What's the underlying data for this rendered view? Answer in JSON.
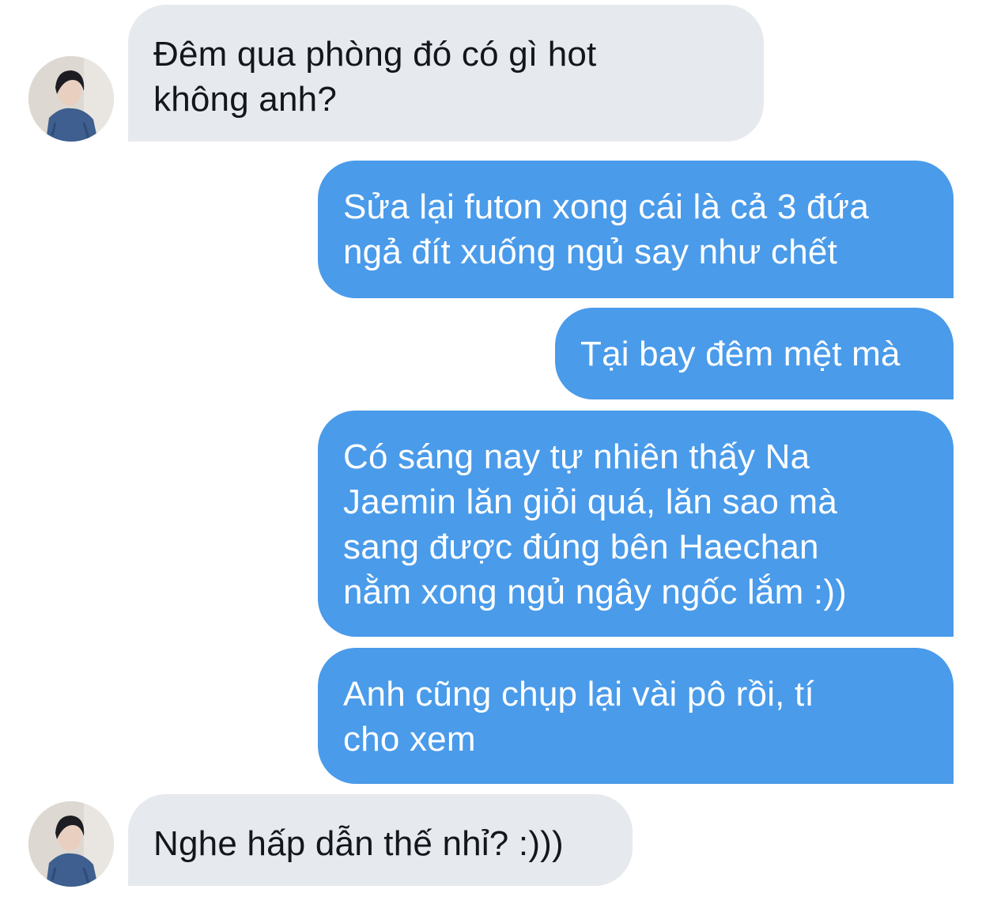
{
  "conversation": {
    "messages": [
      {
        "sender": "other",
        "lines": [
          "Đêm qua phòng đó có gì hot",
          "không anh?"
        ]
      },
      {
        "sender": "me",
        "lines": [
          "Sửa lại futon xong cái là cả 3 đứa",
          "ngả đít xuống ngủ say như chết"
        ]
      },
      {
        "sender": "me",
        "lines": [
          "Tại bay đêm mệt mà"
        ]
      },
      {
        "sender": "me",
        "lines": [
          "Có sáng nay tự nhiên thấy Na",
          "Jaemin lăn giỏi quá, lăn sao mà",
          "sang được đúng bên Haechan",
          "nằm xong ngủ ngây ngốc lắm :))"
        ]
      },
      {
        "sender": "me",
        "lines": [
          "Anh cũng chụp lại vài pô rồi, tí",
          "cho xem"
        ]
      },
      {
        "sender": "other",
        "lines": [
          "Nghe hấp dẫn thế nhỉ? :)))"
        ]
      }
    ]
  },
  "colors": {
    "incoming_bubble": "#e6e9ee",
    "outgoing_bubble": "#4a9bea",
    "incoming_text": "#14171a",
    "outgoing_text": "#ffffff"
  },
  "icons": {
    "avatar": "profile-photo-avatar"
  }
}
